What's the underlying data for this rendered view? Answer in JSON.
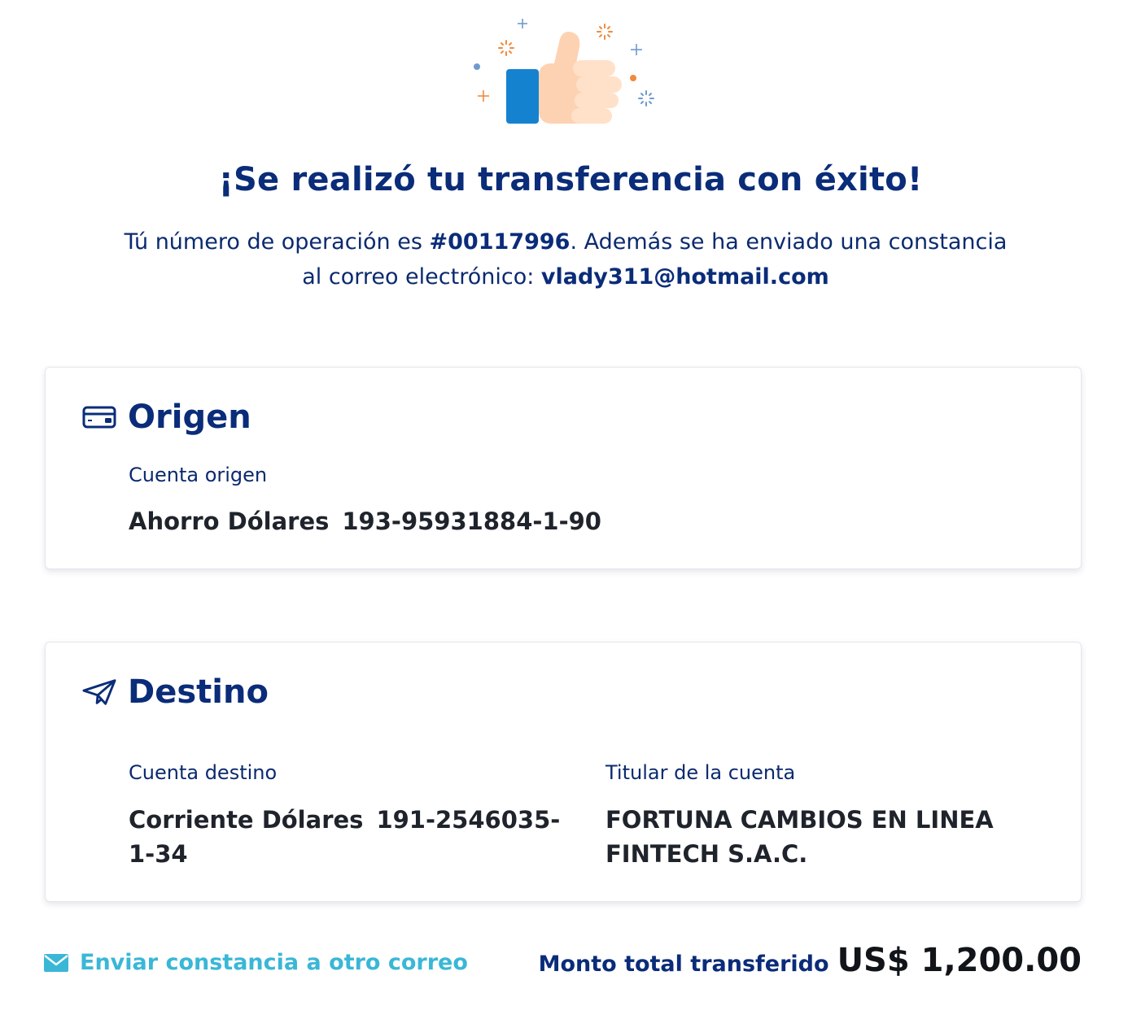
{
  "colors": {
    "primary": "#0a2c79",
    "accent_link": "#3ab7d6",
    "text_dark": "#1f232b",
    "thumb_blue": "#1582d0",
    "thumb_skin": "#fdd2b3",
    "confetti_orange": "#f08a3c"
  },
  "icons": {
    "hero": "thumbs-up-illustration",
    "origin": "credit-card-icon",
    "destination": "paper-plane-icon",
    "email": "envelope-icon"
  },
  "header": {
    "title": "¡Se realizó tu transferencia con éxito!",
    "message_prefix": "Tú número de operación es ",
    "operation_number": "#00117996",
    "message_middle": ". Además se ha enviado una constancia al correo electrónico: ",
    "email": "vlady311@hotmail.com"
  },
  "origin": {
    "title": "Origen",
    "account_label": "Cuenta origen",
    "account_type": "Ahorro Dólares",
    "account_number": "193-95931884-1-90"
  },
  "destination": {
    "title": "Destino",
    "account_label": "Cuenta destino",
    "account_type": "Corriente Dólares",
    "account_number": "191-2546035-1-34",
    "holder_label": "Titular de la cuenta",
    "holder_name": "FORTUNA CAMBIOS EN LINEA FINTECH S.A.C."
  },
  "footer": {
    "send_receipt_label": "Enviar constancia a otro correo",
    "total_label": "Monto total transferido",
    "total_amount": "US$ 1,200.00"
  }
}
